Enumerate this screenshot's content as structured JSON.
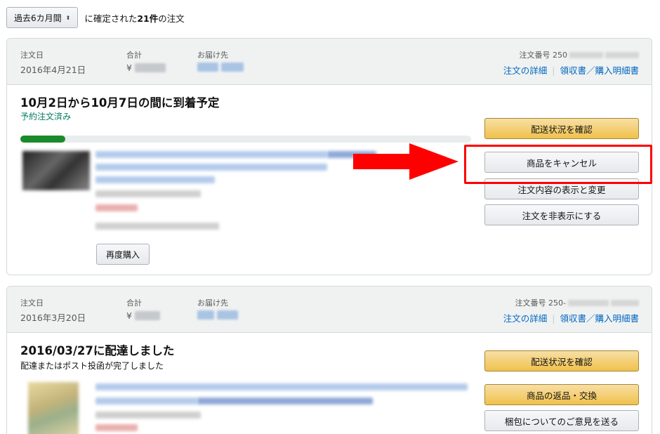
{
  "filter": {
    "period_label": "過去6カ月間",
    "caret": "⬍",
    "text_prefix": "に確定された",
    "count": "21件",
    "text_suffix": "の注文"
  },
  "labels": {
    "order_date": "注文日",
    "total": "合計",
    "ship_to": "お届け先",
    "currency": "¥",
    "order_details": "注文の詳細",
    "receipt": "領収書／購入明細書",
    "separator": "|"
  },
  "orders": [
    {
      "date": "2016年4月21日",
      "order_number_prefix": "注文番号 250",
      "status_title": "10月2日から10月7日の間に到着予定",
      "status_sub": "予約注文済み",
      "progress_fraction": 0.1,
      "rebuy_label": "再度購入",
      "actions": [
        "配送状況を確認",
        "商品をキャンセル",
        "注文内容の表示と変更",
        "注文を非表示にする"
      ]
    },
    {
      "date": "2016年3月20日",
      "order_number_prefix": "注文番号 250-",
      "status_title": "2016/03/27に配達しました",
      "status_sub": "配達またはポスト投函が完了しました",
      "actions": [
        "配送状況を確認",
        "商品の返品・交換",
        "梱包についてのご意見を送る"
      ]
    }
  ],
  "colors": {
    "highlight": "#ff0000",
    "link": "#0066c0",
    "progress": "#1b8a2a",
    "status_green": "#067d62"
  }
}
